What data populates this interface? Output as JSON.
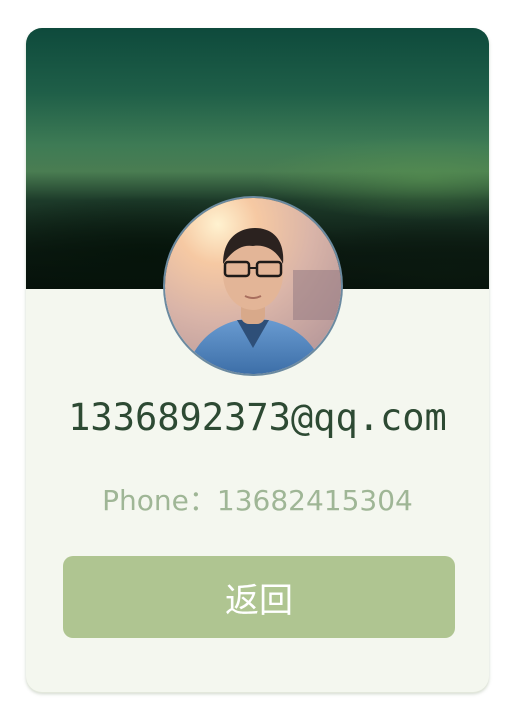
{
  "profile": {
    "email": "1336892373@qq.com",
    "phone_label": "Phone：",
    "phone_number": "13682415304"
  },
  "actions": {
    "back_label": "返回"
  },
  "colors": {
    "card_background": "#f4f7ef",
    "email_text": "#2d4a33",
    "phone_text": "#9fb696",
    "button_background": "#afc591",
    "button_text": "#ffffff"
  }
}
